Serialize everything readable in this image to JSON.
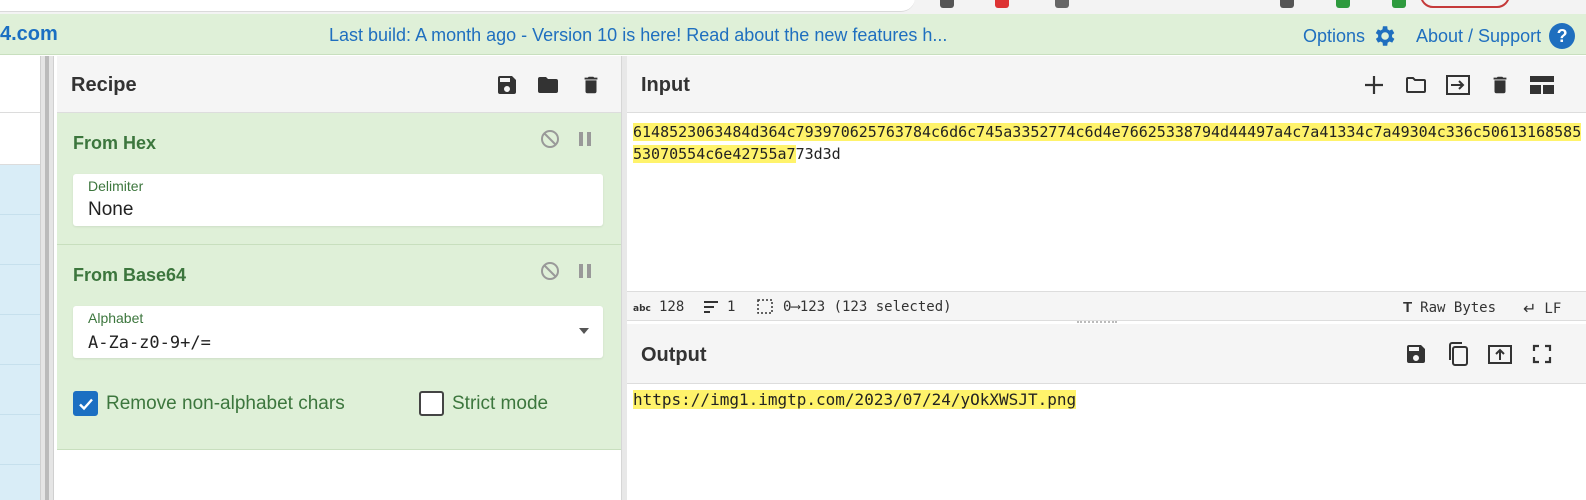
{
  "banner": {
    "logo": "4.com",
    "notice": "Last build: A month ago - Version 10 is here! Read about the new features h...",
    "options_label": "Options",
    "about_label": "About / Support",
    "help_glyph": "?"
  },
  "recipe": {
    "title": "Recipe",
    "icons": [
      "save-icon",
      "folder-icon",
      "trash-icon"
    ],
    "operations": [
      {
        "name": "From Hex",
        "field_label": "Delimiter",
        "field_value": "None"
      },
      {
        "name": "From Base64",
        "field_label": "Alphabet",
        "field_value": "A-Za-z0-9+/=",
        "checkboxes": [
          {
            "label": "Remove non-alphabet chars",
            "checked": true
          },
          {
            "label": "Strict mode",
            "checked": false
          }
        ]
      }
    ]
  },
  "input": {
    "title": "Input",
    "icons": [
      "plus-icon",
      "folder-icon",
      "import-icon",
      "trash-icon",
      "layout-icon"
    ],
    "text_selected": "6148523063484d364c793970625763784c6d6c745a3352774c6d4e76625338794d44497a4c7a41334c7a49304c336c5061316858553070554c6e42755a7",
    "text_rest": "73d3d",
    "status": {
      "length": "128",
      "lines": "1",
      "selection": "0⟶123 (123 selected)",
      "encoding": "Raw Bytes",
      "eol": "LF"
    }
  },
  "output": {
    "title": "Output",
    "icons": [
      "save-icon",
      "copy-icon",
      "replace-input-icon",
      "fullscreen-icon"
    ],
    "text": "https://img1.imgtp.com/2023/07/24/yOkXWSJT.png"
  },
  "colors": {
    "banner_bg": "#dff0d8",
    "link": "#1f6fbf",
    "operation_green": "#3c763d",
    "highlight": "#fff36b"
  }
}
